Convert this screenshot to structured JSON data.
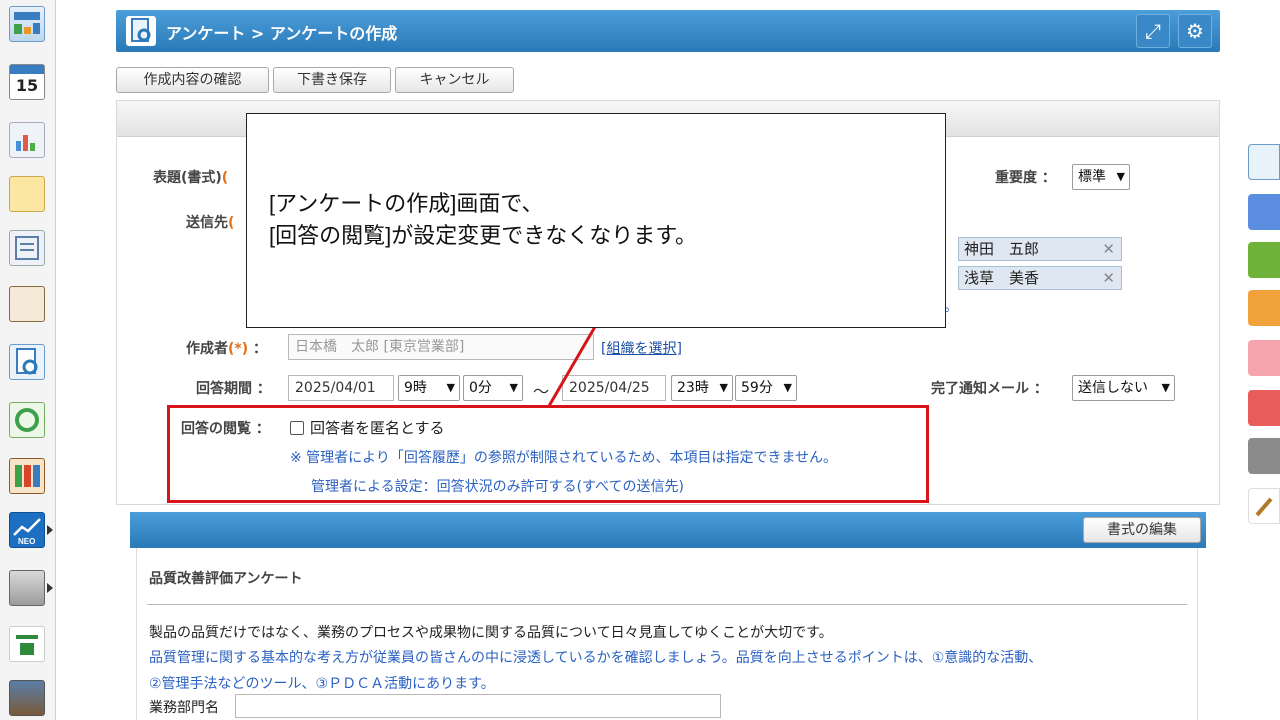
{
  "header": {
    "title": "アンケート > アンケートの作成"
  },
  "toolbar": {
    "confirm": "作成内容の確認",
    "draft": "下書き保存",
    "cancel": "キャンセル"
  },
  "form": {
    "subject_label": "表題(書式)",
    "recipient_label": "送信先",
    "required_mark": "(*)",
    "partial_required_mark": "(",
    "importance_label": "重要度",
    "importance_value": "標準",
    "recipients": [
      "神田　五郎",
      "浅草　美香"
    ],
    "trailing_dot": "。",
    "creator_label": "作成者",
    "creator_value": "日本橋　太郎 [東京営業部]",
    "select_org_link": "[組織を選択]",
    "period_label": "回答期間",
    "colon": "：",
    "start_date": "2025/04/01",
    "start_hour": "9時",
    "start_min": "0分",
    "tilde": "～",
    "end_date": "2025/04/25",
    "end_hour": "23時",
    "end_min": "59分",
    "notify_label": "完了通知メール",
    "notify_value": "送信しない",
    "view_label": "回答の閲覧",
    "anonymous_label": "回答者を匿名とする",
    "note1": "※ 管理者により「回答履歴」の参照が制限されているため、本項目は指定できません。",
    "note2": "管理者による設定：回答状況のみ許可する(すべての送信先)"
  },
  "callout": {
    "line1": "[アンケートの作成]画面で、",
    "line2": "[回答の閲覧]が設定変更できなくなります。"
  },
  "survey": {
    "edit_button": "書式の編集",
    "title": "品質改善評価アンケート",
    "line1": "製品の品質だけではなく、業務のプロセスや成果物に関する品質について日々見直してゆくことが大切です。",
    "line2": "品質管理に関する基本的な考え方が従業員の皆さんの中に浸透しているかを確認しましょう。品質を向上させるポイントは、①意識的な活動、",
    "line3": "②管理手法などのツール、③ＰＤＣＡ活動にあります。",
    "dept_label": "業務部門名"
  },
  "sidebar_badge": "15",
  "colors": {
    "header_blue": "#2a79b8",
    "highlight_red": "#d8141a",
    "note_blue": "#2b62c2",
    "required_orange": "#e0701a"
  }
}
